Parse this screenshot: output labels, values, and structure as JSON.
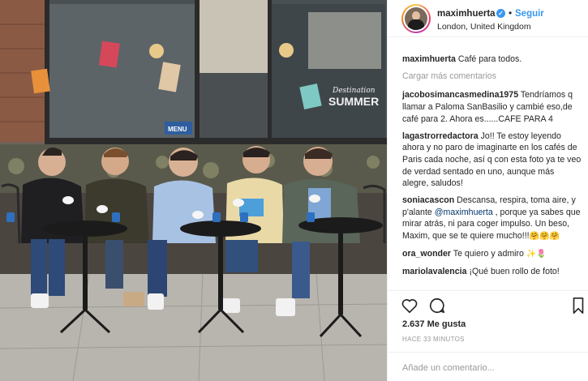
{
  "post": {
    "username": "maximhuerta",
    "verified_glyph": "✓",
    "separator": "•",
    "follow_label": "Seguir",
    "location": "London, United Kingdom",
    "caption_user": "maximhuerta",
    "caption_text": " Café para todos.",
    "load_more": "Cargar más comentarios",
    "likes": "2.637 Me gusta",
    "time_ago": "HACE 33 MINUTOS",
    "add_comment_placeholder": "Añade un comentario..."
  },
  "comments": [
    {
      "user": "jacobosimancasmedina1975",
      "text": " Tendríamos q llamar a Paloma SanBasilio y cambié eso,de café para 2. Ahora es......CAFE PARA 4"
    },
    {
      "user": "lagastrorredactora",
      "text": " Jo!! Te estoy leyendo ahora y no paro de imaginarte en los cafés de Paris cada noche, así q con esta foto ya te veo de verdad sentado en uno, aunque más alegre, saludos!"
    },
    {
      "user": "soniacascon",
      "text_before": " Descansa, respira, toma aire, y p'alante ",
      "mention": "@maximhuerta",
      "text_after": " , porque ya sabes que mirar atrás, ni para coger impulso. Un beso, Maxim, que se te quiere mucho!!!",
      "emoji": "🤗🤗🤗"
    },
    {
      "user": "ora_wonder",
      "text": " Te quiero y admiro ",
      "emoji": "✨🌷"
    },
    {
      "user": "mariolavalencia",
      "text": " ¡Qué buen rollo de foto!"
    }
  ],
  "photo": {
    "sign_text": "Destination",
    "sign_text2": "SUMMER",
    "menu_text": "MENU"
  },
  "icons": [
    "heart-icon",
    "comment-icon",
    "bookmark-icon",
    "verified-badge-icon"
  ],
  "colors": {
    "link": "#3897f0",
    "mention": "#003569",
    "muted": "#999999",
    "text": "#262626"
  }
}
